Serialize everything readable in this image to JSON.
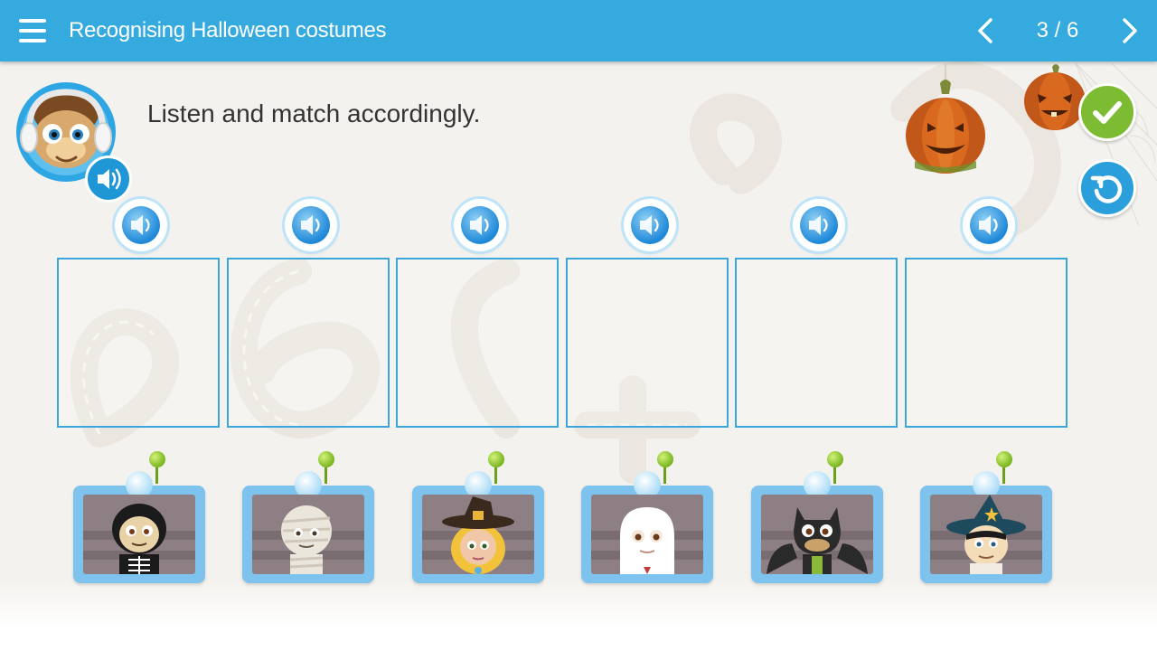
{
  "header": {
    "title": "Recognising Halloween costumes",
    "page_counter": "3 / 6"
  },
  "instruction": "Listen and match accordingly.",
  "colors": {
    "header": "#35aadf",
    "check_button": "#7dbb32",
    "reset_button": "#2a9fdc",
    "slot_border": "#3aa6dc",
    "card": "#7ec3ee"
  },
  "icons": {
    "menu": "hamburger-icon",
    "prev": "chevron-left-icon",
    "next": "chevron-right-icon",
    "check": "checkmark-icon",
    "reset": "reset-icon",
    "sound": "speaker-icon"
  },
  "slots": [
    {
      "sound": "audio-clip-1"
    },
    {
      "sound": "audio-clip-2"
    },
    {
      "sound": "audio-clip-3"
    },
    {
      "sound": "audio-clip-4"
    },
    {
      "sound": "audio-clip-5"
    },
    {
      "sound": "audio-clip-6"
    }
  ],
  "costume_cards": [
    {
      "costume": "skeleton"
    },
    {
      "costume": "mummy"
    },
    {
      "costume": "witch"
    },
    {
      "costume": "ghost"
    },
    {
      "costume": "bat"
    },
    {
      "costume": "wizard"
    }
  ]
}
